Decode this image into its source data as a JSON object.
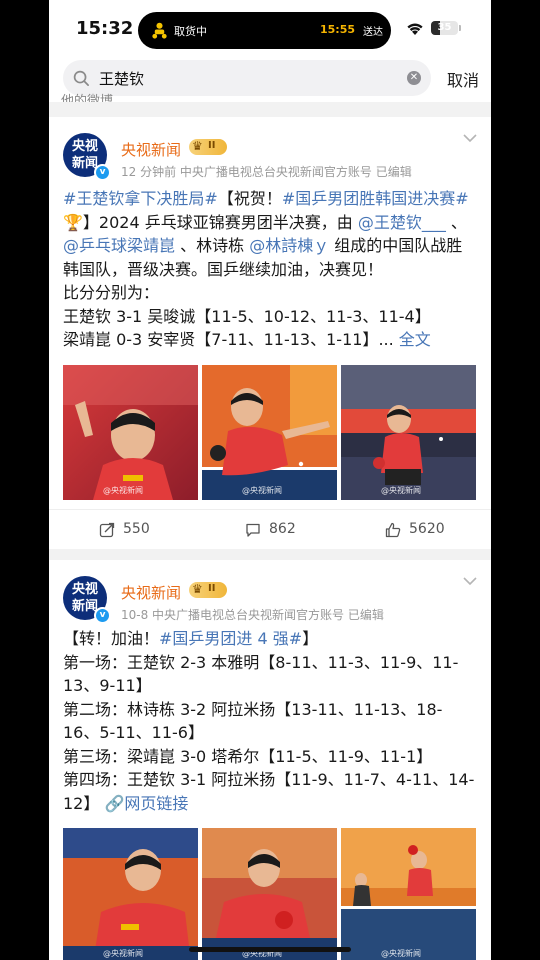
{
  "status_bar": {
    "time": "15:32",
    "activity_label": "取货中",
    "activity_time": "15:55",
    "activity_suffix": "送达",
    "battery": "35"
  },
  "search": {
    "query": "王楚钦",
    "cancel_label": "取消",
    "peek_text": "他的微博"
  },
  "posts": [
    {
      "author": "央视新闻",
      "avatar_line1": "央视",
      "avatar_line2": "新闻",
      "level": "II",
      "meta": "12 分钟前  中央广播电视总台央视新闻官方账号  已编辑",
      "tag1": "#王楚钦拿下决胜局#",
      "t1": "【祝贺！",
      "tag2": "#国乒男团胜韩国进决赛#",
      "emoji": "🏆",
      "t2": "】2024 乒乓球亚锦赛男团半决赛，由 ",
      "mention1": "@王楚钦___",
      "t3": " 、",
      "mention2": "@乒乓球梁靖崑",
      "t4": " 、林诗栋 ",
      "mention3": "@林詩棟ｙ",
      "t5": " 组成的中国队战胜韩国队，晋级决赛。国乒继续加油，决赛见！",
      "line_score_title": "比分分别为：",
      "line_a": "王楚钦 3-1 吴晙诚【11-5、10-12、11-3、11-4】",
      "line_b": "梁靖崑 0-3 安宰贤【7-11、11-13、1-11】",
      "ellipsis": "...",
      "more": "全文",
      "repost": "550",
      "comment": "862",
      "like": "5620",
      "watermark": "@央视新闻"
    },
    {
      "author": "央视新闻",
      "avatar_line1": "央视",
      "avatar_line2": "新闻",
      "level": "II",
      "meta": "10-8  中央广播电视总台央视新闻官方账号  已编辑",
      "t0": "【转！加油！",
      "tag1": "#国乒男团进 4 强#",
      "t1": "】",
      "line1": "第一场：王楚钦 2-3 本雅明【8-11、11-3、11-9、11-13、9-11】",
      "line2": "第二场：林诗栋 3-2 阿拉米扬【13-11、11-13、18-16、5-11、11-6】",
      "line3": "第三场：梁靖崑 3-0 塔希尔【11-5、11-9、11-1】",
      "line4": "第四场：王楚钦 3-1 阿拉米扬【11-9、11-7、4-11、14-12】",
      "link": "网页链接",
      "watermark": "@央视新闻"
    }
  ],
  "colors": {
    "link_blue": "#4876b6",
    "author_orange": "#e86b18",
    "card_bg": "#ffffff",
    "page_bg": "#f2f2f2"
  }
}
